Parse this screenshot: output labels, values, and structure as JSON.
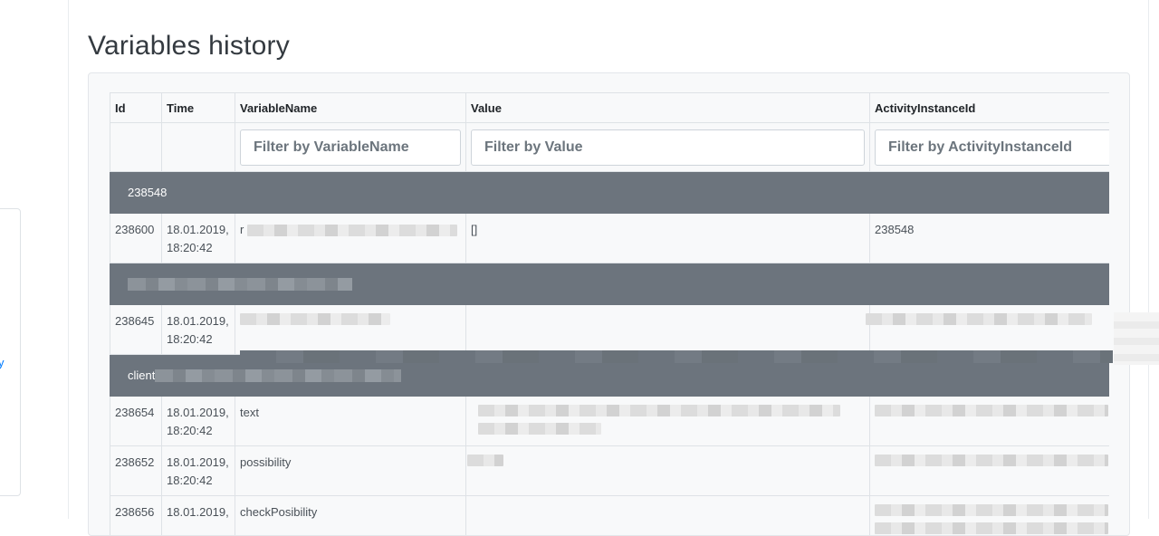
{
  "page": {
    "title": "Variables history"
  },
  "table": {
    "columns": [
      "Id",
      "Time",
      "VariableName",
      "Value",
      "ActivityInstanceId"
    ],
    "filters": {
      "variable_name": "Filter by VariableName",
      "value": "Filter by Value",
      "activity_instance_id": "Filter by ActivityInstanceId"
    },
    "groups": [
      {
        "label": "238548",
        "rows": [
          {
            "id": "238600",
            "date": "18.01.2019,",
            "time": "18:20:42",
            "variable_name": "r",
            "value": "[]",
            "activity_instance_id": "238548"
          }
        ]
      },
      {
        "label": "",
        "rows": [
          {
            "id": "238645",
            "date": "18.01.2019,",
            "time": "18:20:42",
            "variable_name": "",
            "value": "",
            "activity_instance_id": ""
          }
        ]
      },
      {
        "label": "client",
        "rows": [
          {
            "id": "238654",
            "date": "18.01.2019,",
            "time": "18:20:42",
            "variable_name": "text",
            "value": "",
            "activity_instance_id": ""
          },
          {
            "id": "238652",
            "date": "18.01.2019,",
            "time": "18:20:42",
            "variable_name": "possibility",
            "value": "",
            "activity_instance_id": ""
          },
          {
            "id": "238656",
            "date": "18.01.2019,",
            "time": "",
            "variable_name": "checkPosibility",
            "value": "",
            "activity_instance_id": ""
          }
        ]
      }
    ]
  },
  "sidebar": {
    "link_glyph": "y"
  }
}
